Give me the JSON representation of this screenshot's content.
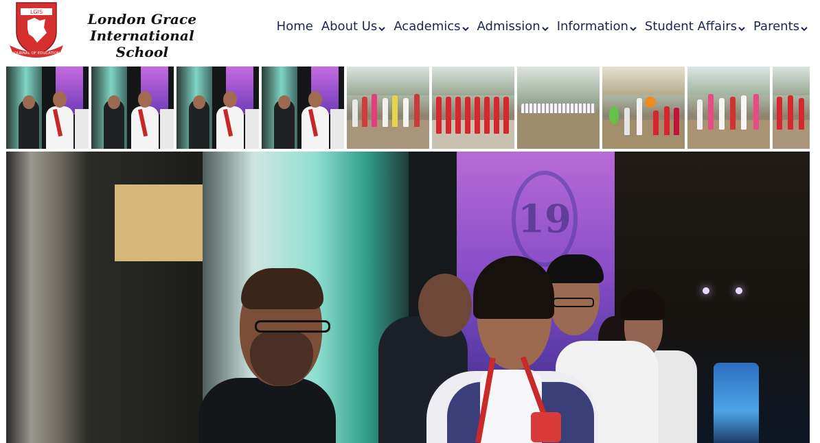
{
  "brand": {
    "name_line1": "London Grace",
    "name_line2": "International School",
    "logo_text_top": "LGIS",
    "logo_text_bottom": "JOURNAL OF EDUCATION",
    "colors": {
      "logo_red": "#d62f2f",
      "nav_text": "#1c2551"
    }
  },
  "nav": {
    "items": [
      {
        "label": "Home",
        "has_dropdown": false
      },
      {
        "label": "About Us",
        "has_dropdown": true
      },
      {
        "label": "Academics",
        "has_dropdown": true
      },
      {
        "label": "Admission",
        "has_dropdown": true
      },
      {
        "label": "Information",
        "has_dropdown": true
      },
      {
        "label": "Student Affairs",
        "has_dropdown": true
      },
      {
        "label": "Parents",
        "has_dropdown": true
      }
    ]
  },
  "gallery": {
    "thumbnails": [
      {
        "kind": "stage"
      },
      {
        "kind": "stage"
      },
      {
        "kind": "stage"
      },
      {
        "kind": "stage"
      },
      {
        "kind": "field"
      },
      {
        "kind": "field"
      },
      {
        "kind": "field"
      },
      {
        "kind": "field"
      },
      {
        "kind": "field"
      },
      {
        "kind": "field"
      }
    ],
    "hero": {
      "logo_text": "19"
    }
  }
}
